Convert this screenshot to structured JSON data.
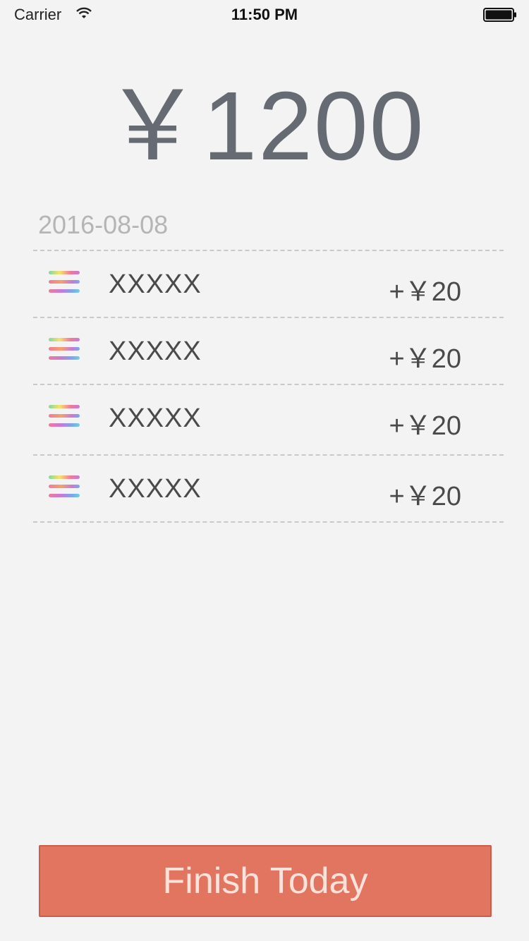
{
  "status_bar": {
    "carrier": "Carrier",
    "time": "11:50 PM",
    "wifi_icon": "wifi-icon",
    "battery_icon": "battery-icon"
  },
  "summary": {
    "total": "￥1200"
  },
  "date": "2016-08-08",
  "items": [
    {
      "icon": "rainbow-lines-icon",
      "name": "XXXXX",
      "amount": "+￥20"
    },
    {
      "icon": "rainbow-lines-icon",
      "name": "XXXXX",
      "amount": "+￥20"
    },
    {
      "icon": "rainbow-lines-icon",
      "name": "XXXXX",
      "amount": "+￥20"
    },
    {
      "icon": "rainbow-lines-icon",
      "name": "XXXXX",
      "amount": "+￥20"
    }
  ],
  "finish_button": {
    "label": "Finish Today",
    "color": "#e2755f"
  }
}
